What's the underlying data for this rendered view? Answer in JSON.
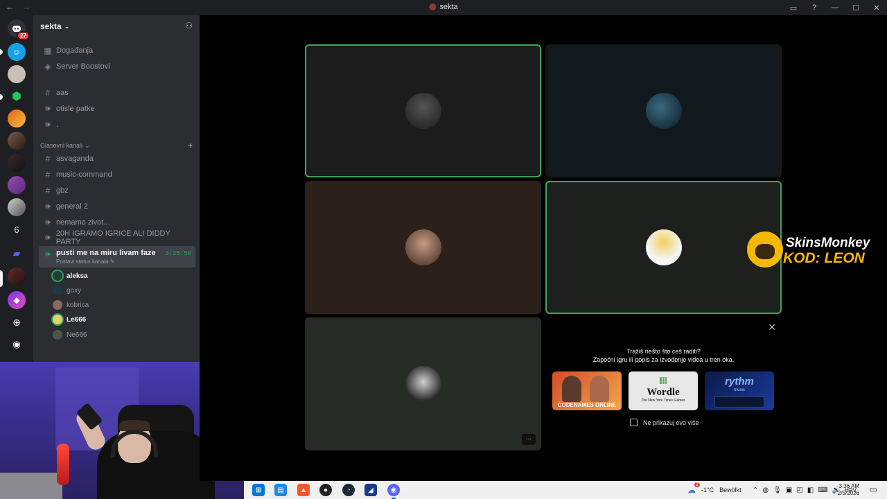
{
  "window": {
    "title": "sekta"
  },
  "rail": {
    "dm_badge": "27",
    "folder_number": "6"
  },
  "server": {
    "name": "sekta",
    "top_items": [
      {
        "label": "Događanja",
        "icon": "calendar-icon"
      },
      {
        "label": "Server Boostovi",
        "icon": "boost-icon"
      }
    ],
    "channels": [
      {
        "label": "aas",
        "type": "text"
      },
      {
        "label": "otisle patke",
        "type": "voice"
      },
      {
        "label": ".",
        "type": "voice"
      }
    ],
    "category": "Glasovni kanali",
    "voice_channels": [
      {
        "label": "asvaganda",
        "type": "text"
      },
      {
        "label": "music-command",
        "type": "text"
      },
      {
        "label": "gbz",
        "type": "text"
      },
      {
        "label": "general 2",
        "type": "voice"
      },
      {
        "label": "nemamo zivot...",
        "type": "voice"
      },
      {
        "label": "20H IGRAMO IGRICE ALI DIDDY PARTY",
        "type": "voice"
      }
    ],
    "active_channel": {
      "label": "pusti me na miru livam faze",
      "timer": "3:25:50",
      "status_hint": "Postavi status kanala"
    },
    "voice_users": [
      {
        "name": "aleksa",
        "speaking": true,
        "bright": true
      },
      {
        "name": "goxy",
        "speaking": false,
        "bright": false
      },
      {
        "name": "kobrica",
        "speaking": false,
        "bright": false
      },
      {
        "name": "Le666",
        "speaking": true,
        "bright": true
      },
      {
        "name": "Ne666",
        "speaking": false,
        "bright": false
      }
    ]
  },
  "activity": {
    "question": "Tražiš nešto što ćeš raditi?",
    "hint": "Započni igru ili popis za izvođenje videa u tren oka.",
    "games": [
      {
        "name": "CODENAMES ONLINE"
      },
      {
        "name": "Wordle",
        "sub": "The New York Times Games"
      },
      {
        "name": "rythm",
        "sub": "music"
      }
    ],
    "dont_show": "Ne prikazuj ovo više",
    "tile_more": "..."
  },
  "sponsor": {
    "line1": "SkinsMonkey",
    "line2": "KOD: LEON"
  },
  "taskbar": {
    "weather": "-1°C",
    "weather_text": "Bewölkt",
    "lang": "HRV",
    "time": "3:36 AM",
    "date": "2/5/2026",
    "notif_badge": "2"
  },
  "colors": {
    "speaking": "#3ba55c",
    "badge": "#f23f43",
    "sidebar": "#2b2d31",
    "rail": "#1e1f22"
  }
}
